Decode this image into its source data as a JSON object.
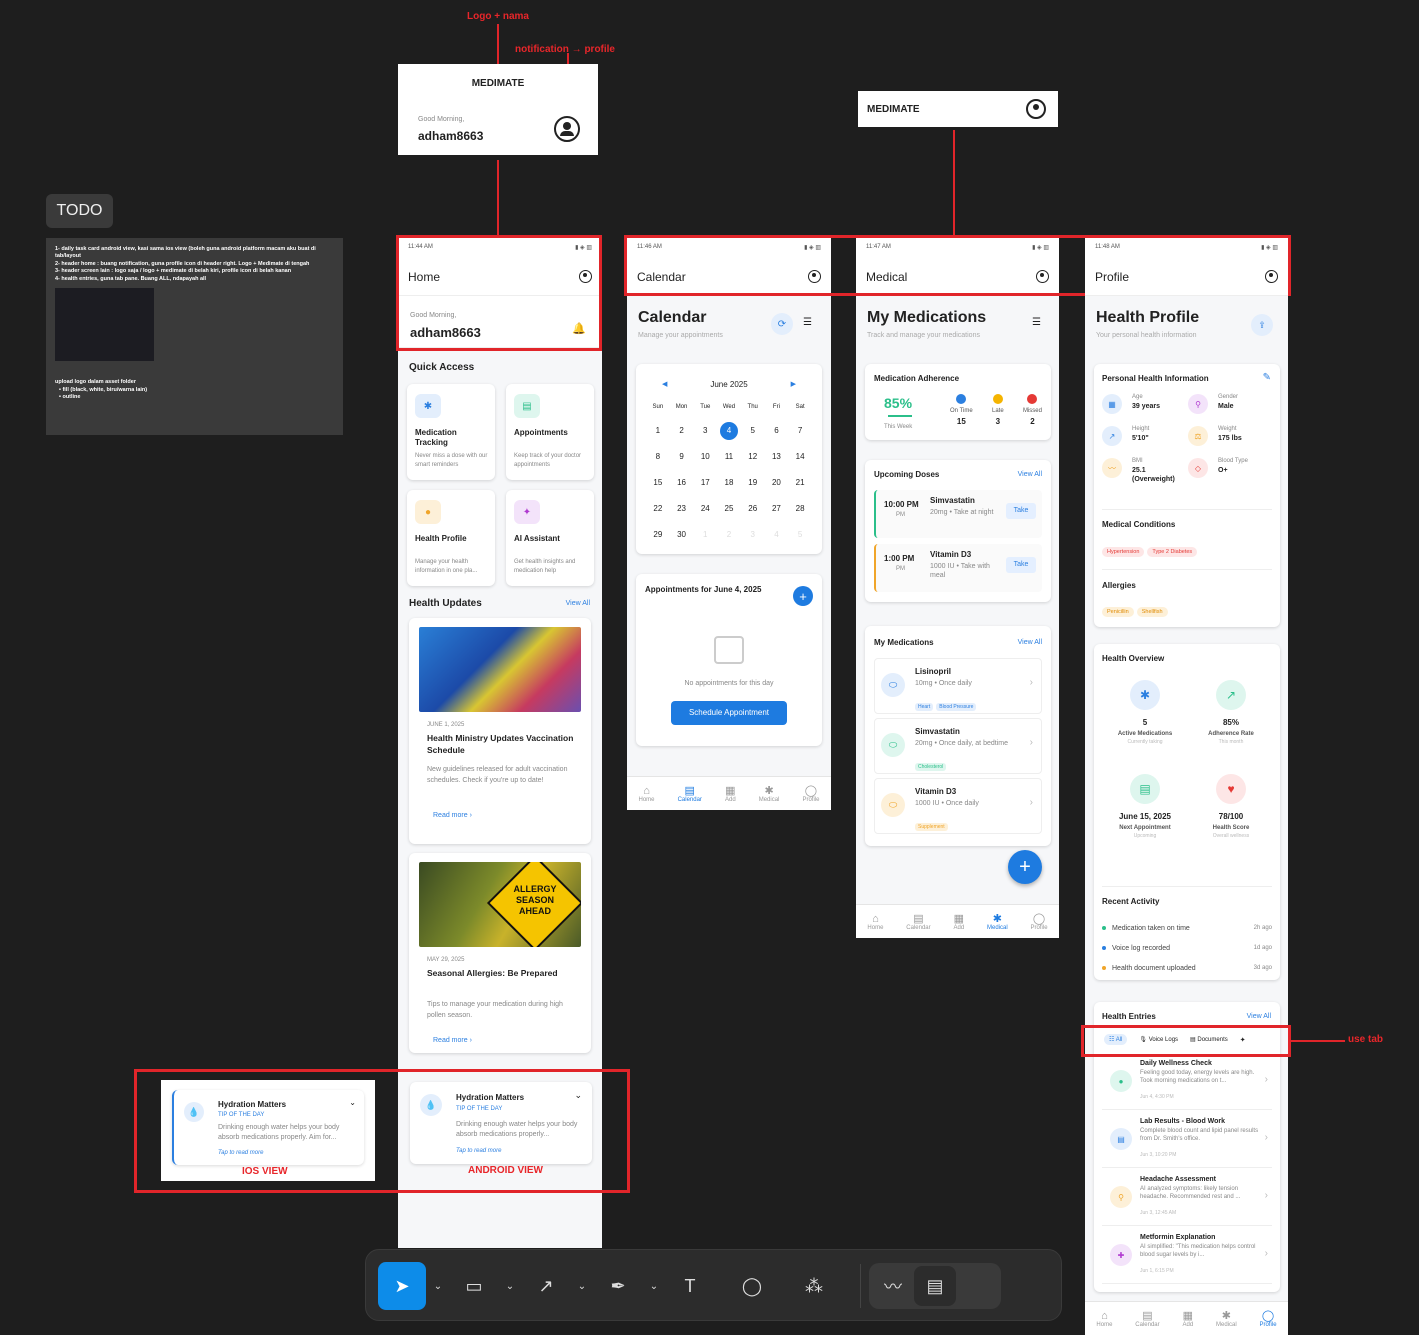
{
  "annotations": {
    "logo": "Logo + nama",
    "notif": "notification → profile",
    "use_tab": "use tab",
    "ios_view": "IOS VIEW",
    "android_view": "ANDROID VIEW"
  },
  "header_mock1": {
    "brand": "MEDIMATE",
    "greeting": "Good Morning,",
    "user": "adham8663"
  },
  "header_mock2": {
    "brand": "MEDIMATE"
  },
  "todo": {
    "title": "TODO",
    "items": [
      "1- daily task card android view, kasi sama ios view (boleh guna android platform macam aku buat di tab/layout",
      "2- header home : buang notification, guna profile icon di header right. Logo + Medimate di tengah",
      "3- header screen lain : logo saja / logo + medimate di belah kiri, profile icon di belah kanan",
      "4- health entries, guna tab pane. Buang ALL, ndapayah all"
    ],
    "upload": "upload logo dalam asset folder",
    "bullets": [
      "• fill (black, white, biru/warna lain)",
      "• outline"
    ]
  },
  "status": {
    "home": "11:44 AM",
    "calendar": "11:46 AM",
    "medical": "11:47 AM",
    "profile": "11:48 AM"
  },
  "nav": [
    "Home",
    "Calendar",
    "Add",
    "Medical",
    "Profile"
  ],
  "home": {
    "title": "Home",
    "greeting": "Good Morning,",
    "user": "adham8663",
    "quick_access": "Quick Access",
    "qa": [
      {
        "t": "Medication Tracking",
        "d": "Never miss a dose with our smart reminders",
        "i": "✱",
        "c": "#e3eefc",
        "fc": "#2b7fe0"
      },
      {
        "t": "Appointments",
        "d": "Keep track of your doctor appointments",
        "i": "▤",
        "c": "#def6ee",
        "fc": "#2bbf8a"
      },
      {
        "t": "Health Profile",
        "d": "Manage your health information in one pla...",
        "i": "●",
        "c": "#fdf0d8",
        "fc": "#f0a52a"
      },
      {
        "t": "AI Assistant",
        "d": "Get health insights and medication help",
        "i": "✦",
        "c": "#f3e3fa",
        "fc": "#b03ad0"
      }
    ],
    "updates": "Health Updates",
    "view_all": "View All",
    "news": [
      {
        "date": "JUNE 1, 2025",
        "title": "Health Ministry Updates Vaccination Schedule",
        "desc": "New guidelines released for adult vaccination schedules. Check if you're up to date!",
        "more": "Read more"
      },
      {
        "date": "MAY 29, 2025",
        "title": "Seasonal Allergies: Be Prepared",
        "desc": "Tips to manage your medication during high pollen season.",
        "more": "Read more",
        "sign": "ALLERGY SEASON AHEAD"
      }
    ]
  },
  "hydration": {
    "title": "Hydration Matters",
    "tag": "TIP OF THE DAY",
    "ios_desc": "Drinking enough water helps your body absorb medications properly. Aim for...",
    "and_desc": "Drinking enough water helps your body absorb medications properly...",
    "tap": "Tap to read more"
  },
  "calendar": {
    "title": "Calendar",
    "h1": "Calendar",
    "sub": "Manage your appointments",
    "month": "June 2025",
    "days": [
      "Sun",
      "Mon",
      "Tue",
      "Wed",
      "Thu",
      "Fri",
      "Sat"
    ],
    "dates": [
      "1",
      "2",
      "3",
      "4",
      "5",
      "6",
      "7",
      "8",
      "9",
      "10",
      "11",
      "12",
      "13",
      "14",
      "15",
      "16",
      "17",
      "18",
      "19",
      "20",
      "21",
      "22",
      "23",
      "24",
      "25",
      "26",
      "27",
      "28",
      "29",
      "30",
      "1",
      "2",
      "3",
      "4",
      "5"
    ],
    "appt_title": "Appointments for June 4, 2025",
    "empty": "No appointments for this day",
    "schedule": "Schedule Appointment"
  },
  "medical": {
    "title": "Medical",
    "h1": "My Medications",
    "sub": "Track and manage your medications",
    "adherence": "Medication Adherence",
    "pct": "85%",
    "week": "This Week",
    "stats": [
      {
        "l": "On Time",
        "v": "15",
        "c": "#2b7fe0"
      },
      {
        "l": "Late",
        "v": "3",
        "c": "#f5b400"
      },
      {
        "l": "Missed",
        "v": "2",
        "c": "#e53935"
      }
    ],
    "upcoming": "Upcoming Doses",
    "view_all": "View All",
    "doses": [
      {
        "time": "10:00 PM",
        "pm": "PM",
        "name": "Simvastatin",
        "d": "20mg • Take at night",
        "btn": "Take",
        "c": "#2bbf8a"
      },
      {
        "time": "1:00 PM",
        "pm": "PM",
        "name": "Vitamin D3",
        "d": "1000 IU • Take with meal",
        "btn": "Take",
        "c": "#f0a52a"
      }
    ],
    "mymeds": "My Medications",
    "meds": [
      {
        "name": "Lisinopril",
        "d": "10mg • Once daily",
        "tags": [
          "Heart",
          "Blood Pressure"
        ],
        "c": "#e3eefc",
        "fc": "#2b7fe0"
      },
      {
        "name": "Simvastatin",
        "d": "20mg • Once daily, at bedtime",
        "tags": [
          "Cholesterol"
        ],
        "c": "#def6ee",
        "fc": "#2bbf8a"
      },
      {
        "name": "Vitamin D3",
        "d": "1000 IU • Once daily",
        "tags": [
          "Supplement"
        ],
        "c": "#fdf0d8",
        "fc": "#f0a52a"
      }
    ]
  },
  "profile": {
    "title": "Profile",
    "h1": "Health Profile",
    "sub": "Your personal health information",
    "phi": "Personal Health Information",
    "info": [
      {
        "l": "Age",
        "v": "39 years",
        "c": "#e3eefc",
        "fc": "#2b7fe0",
        "i": "▦"
      },
      {
        "l": "Gender",
        "v": "Male",
        "c": "#f3e3fa",
        "fc": "#b03ad0",
        "i": "⚲"
      },
      {
        "l": "Height",
        "v": "5'10\"",
        "c": "#e3eefc",
        "fc": "#2b7fe0",
        "i": "↗"
      },
      {
        "l": "Weight",
        "v": "175 lbs",
        "c": "#fdf0d8",
        "fc": "#f0a52a",
        "i": "⚖"
      },
      {
        "l": "BMI",
        "v": "25.1 (Overweight)",
        "c": "#fdf0d8",
        "fc": "#f0a52a",
        "i": "〰"
      },
      {
        "l": "Blood Type",
        "v": "O+",
        "c": "#fde6e6",
        "fc": "#e53935",
        "i": "◇"
      }
    ],
    "conditions": "Medical Conditions",
    "cond": [
      "Hypertension",
      "Type 2 Diabetes"
    ],
    "allergies": "Allergies",
    "allergy": [
      "Penicillin",
      "Shellfish"
    ],
    "overview": "Health Overview",
    "ov": [
      {
        "v": "5",
        "l": "Active Medications",
        "s": "Currently taking",
        "c": "#e3eefc",
        "fc": "#2b7fe0",
        "i": "✱"
      },
      {
        "v": "85%",
        "l": "Adherence Rate",
        "s": "This month",
        "c": "#def6ee",
        "fc": "#2bbf8a",
        "i": "↗"
      },
      {
        "v": "June 15, 2025",
        "l": "Next Appointment",
        "s": "Upcoming",
        "c": "#def6ee",
        "fc": "#2bbf8a",
        "i": "▤"
      },
      {
        "v": "78/100",
        "l": "Health Score",
        "s": "Overall wellness",
        "c": "#fde6e6",
        "fc": "#e53935",
        "i": "♥"
      }
    ],
    "recent": "Recent Activity",
    "activity": [
      {
        "t": "Medication taken on time",
        "a": "2h ago",
        "c": "#2bbf8a"
      },
      {
        "t": "Voice log recorded",
        "a": "1d ago",
        "c": "#2b7fe0"
      },
      {
        "t": "Health document uploaded",
        "a": "3d ago",
        "c": "#f0a52a"
      }
    ],
    "entries": "Health Entries",
    "view_all": "View All",
    "tabs": [
      "All",
      "Voice Logs",
      "Documents"
    ],
    "entry": [
      {
        "t": "Daily Wellness Check",
        "d": "Feeling good today, energy levels are high. Took morning medications on t...",
        "date": "Jun 4, 4:30 PM",
        "c": "#def6ee",
        "fc": "#2bbf8a",
        "i": "●"
      },
      {
        "t": "Lab Results - Blood Work",
        "d": "Complete blood count and lipid panel results from Dr. Smith's office.",
        "date": "Jun 3, 10:20 PM",
        "c": "#e3eefc",
        "fc": "#2b7fe0",
        "i": "▤"
      },
      {
        "t": "Headache Assessment",
        "d": "AI analyzed symptoms: likely tension headache. Recommended rest and ...",
        "date": "Jun 3, 12:45 AM",
        "c": "#fdf0d8",
        "fc": "#f0a52a",
        "i": "⚲"
      },
      {
        "t": "Metformin Explanation",
        "d": "AI simplified: \"This medication helps control blood sugar levels by i...",
        "date": "Jun 1, 6:15 PM",
        "c": "#f3e3fa",
        "fc": "#b03ad0",
        "i": "✚"
      }
    ]
  },
  "toolbar": [
    {
      "n": "move-tool",
      "i": "➤"
    },
    {
      "n": "frame-tool",
      "i": "▭"
    },
    {
      "n": "arrow-tool",
      "i": "↗"
    },
    {
      "n": "pen-tool",
      "i": "✒"
    },
    {
      "n": "text-tool",
      "i": "T"
    },
    {
      "n": "comment-tool",
      "i": "◯"
    },
    {
      "n": "shapes-tool",
      "i": "⁂"
    },
    {
      "n": "draw-tool",
      "i": "〰"
    },
    {
      "n": "dev-mode-tool",
      "i": "▤"
    },
    {
      "n": "code-tool",
      "i": "</>"
    }
  ]
}
